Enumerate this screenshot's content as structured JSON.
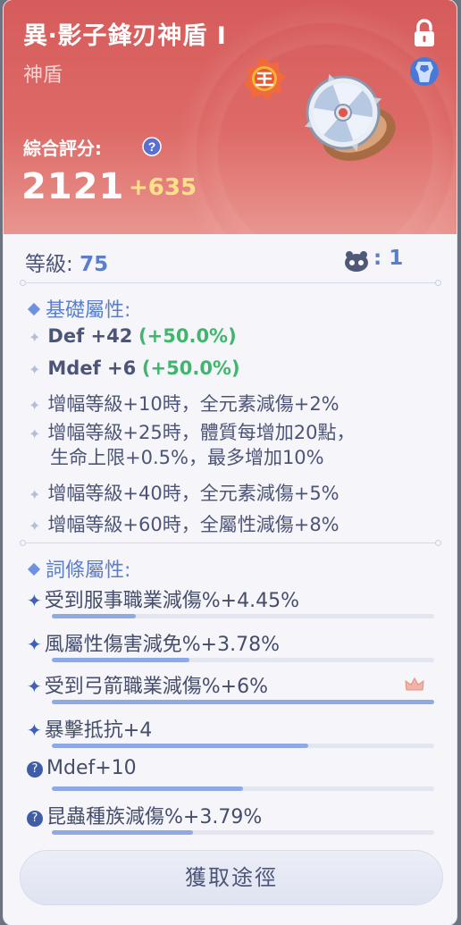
{
  "item": {
    "name": "異‧影子鋒刃神盾 I",
    "type": "神盾",
    "score_label": "綜合評分:",
    "score": "2121",
    "score_bonus": "+635"
  },
  "level": {
    "label": "等級:",
    "value": "75"
  },
  "pet": {
    "count_text": ": 1"
  },
  "base_section": {
    "title": "基礎屬性:",
    "stats": [
      {
        "name": "Def +42",
        "bonus": "(+50.0%)"
      },
      {
        "name": "Mdef +6",
        "bonus": "(+50.0%)"
      }
    ],
    "enhance": [
      {
        "text": "增幅等級+10時，全元素減傷+2%"
      },
      {
        "line1": "增幅等級+25時，體質每增加20點，",
        "line2": "生命上限+0.5%，最多增加10%"
      },
      {
        "text": "增幅等級+40時，全元素減傷+5%"
      },
      {
        "text": "增幅等級+60時，全屬性減傷+8%"
      }
    ]
  },
  "entry_section": {
    "title": "詞條屬性:",
    "attributes": [
      {
        "marker": "✦",
        "text": "受到服事職業減傷%+4.45%",
        "progress": 0.22
      },
      {
        "marker": "✦",
        "text": "風屬性傷害減免%+3.78%",
        "progress": 0.36
      },
      {
        "marker": "✦",
        "text": "受到弓箭職業減傷%+6%",
        "progress": 1.0,
        "crown": true
      },
      {
        "marker": "✦",
        "text": "暴擊抵抗+4",
        "progress": 0.67
      },
      {
        "marker": "?",
        "text": "Mdef+10",
        "progress": 0.5
      },
      {
        "marker": "?",
        "text": "昆蟲種族減傷%+3.79%",
        "progress": 0.37
      }
    ]
  },
  "obtain_button": {
    "label": "獲取途徑"
  },
  "colors": {
    "header_red": "#d65c5c",
    "accent_blue": "#5b7ec9",
    "bonus_green": "#3fb66d",
    "score_gold": "#ffe08a",
    "progress_fill": "#8fa9e6"
  },
  "icons": [
    "lock-icon",
    "shield-class-icon",
    "king-badge-icon",
    "help-icon",
    "pet-icon",
    "crown-icon"
  ]
}
